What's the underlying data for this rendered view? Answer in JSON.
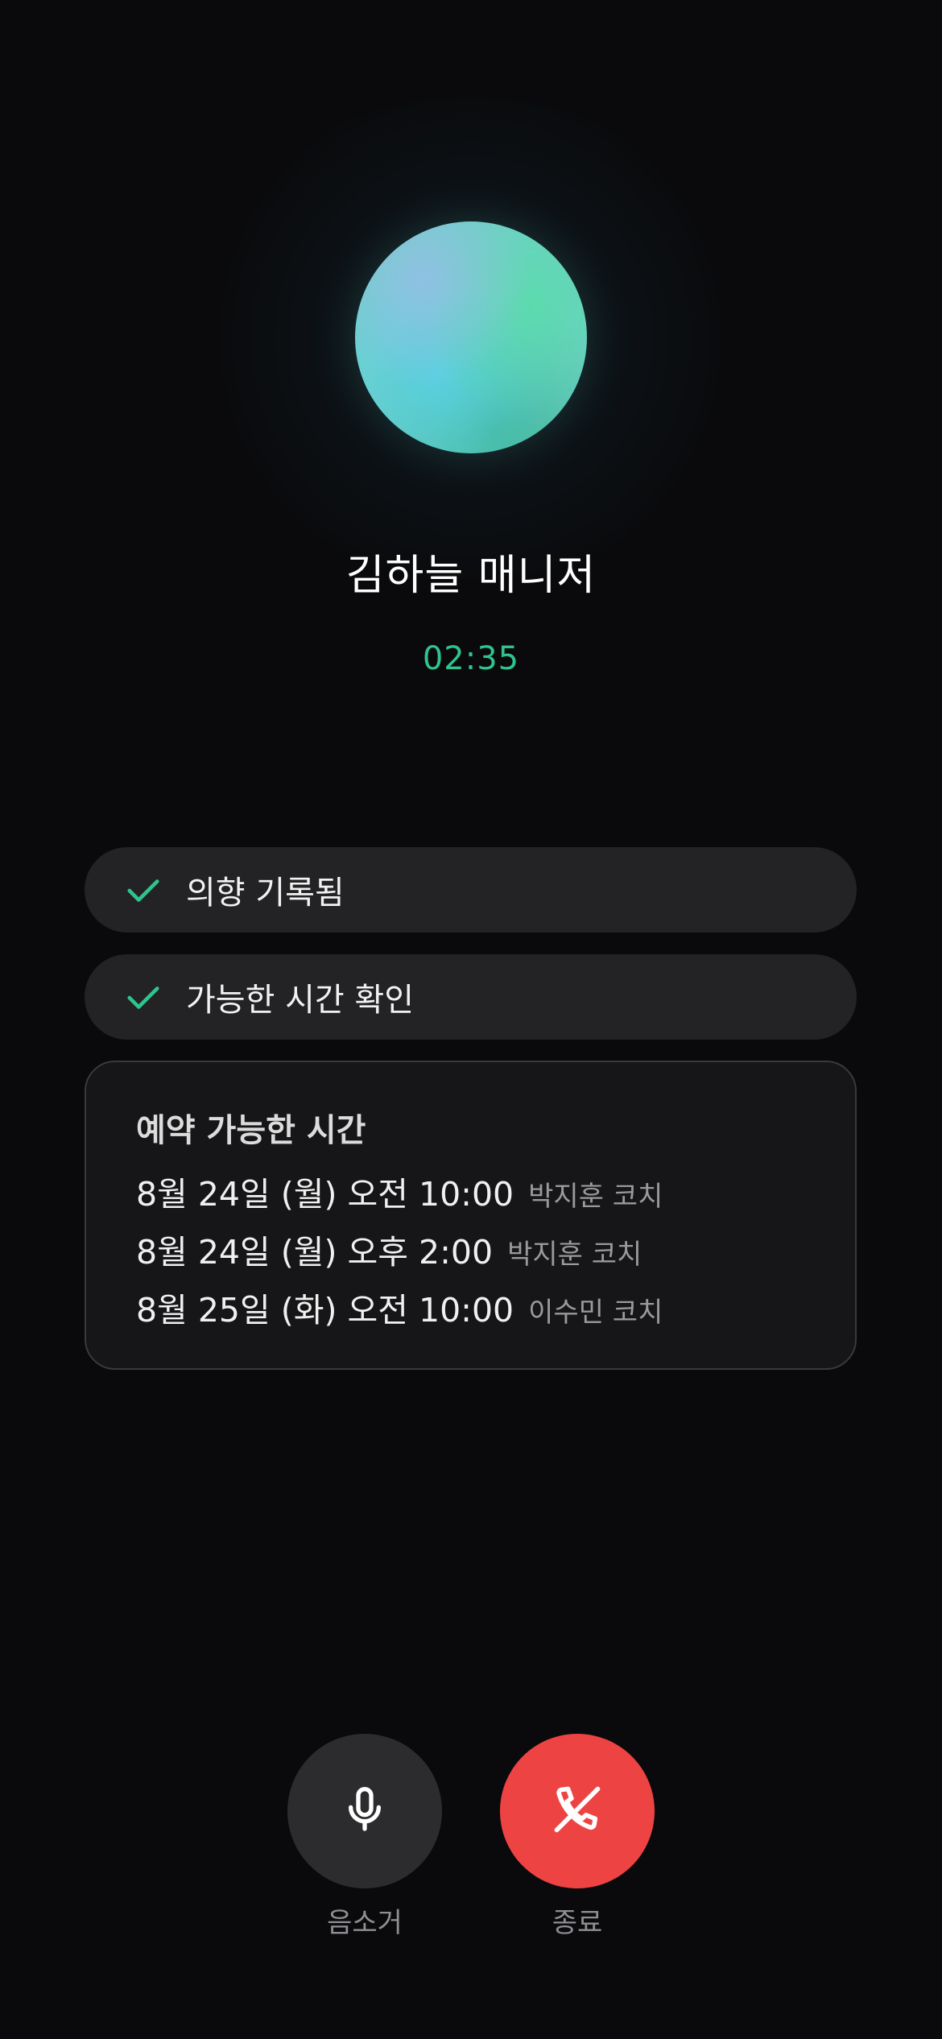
{
  "call": {
    "name": "김하늘 매니저",
    "duration": "02:35"
  },
  "status_items": [
    {
      "label": "의향 기록됨",
      "icon": "check-icon",
      "color": "#2fc48d"
    },
    {
      "label": "가능한 시간 확인",
      "icon": "check-icon",
      "color": "#2fc48d"
    }
  ],
  "slots": {
    "title": "예약 가능한 시간",
    "items": [
      {
        "time": "8월 24일 (월) 오전 10:00",
        "coach": "박지훈 코치"
      },
      {
        "time": "8월 24일 (월) 오후 2:00",
        "coach": "박지훈 코치"
      },
      {
        "time": "8월 25일 (화) 오전 10:00",
        "coach": "이수민 코치"
      }
    ]
  },
  "controls": {
    "mute_label": "음소거",
    "mute_icon": "microphone-icon",
    "end_label": "종료",
    "end_icon": "phone-off-icon",
    "end_color": "#ee4343"
  },
  "colors": {
    "background": "#0a0a0c",
    "accent": "#2fc48d"
  }
}
